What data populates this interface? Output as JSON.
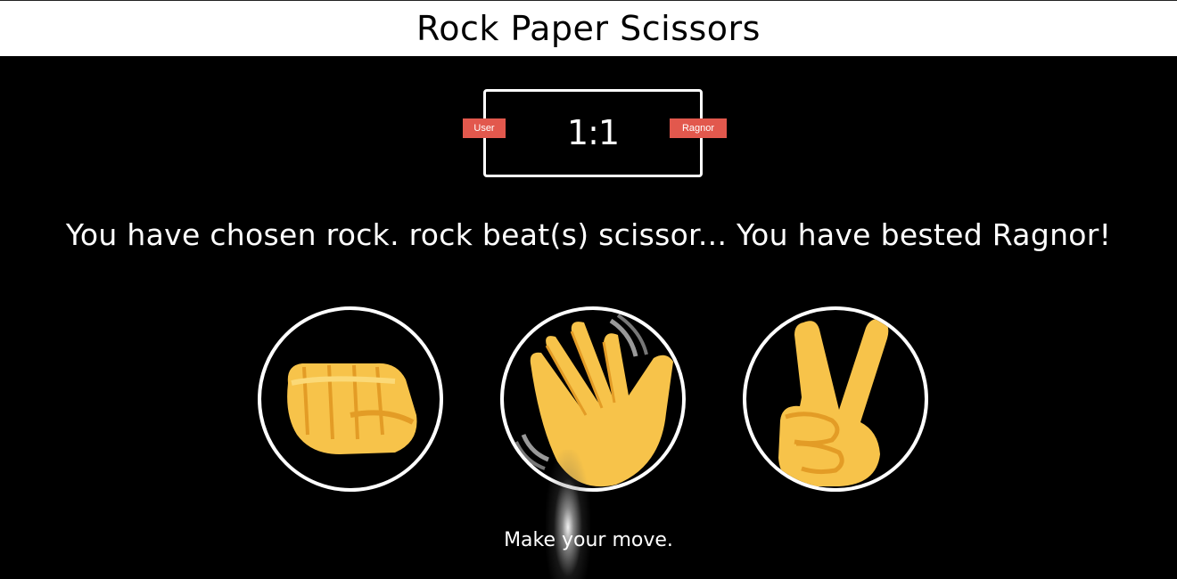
{
  "header": {
    "title": "Rock Paper Scissors"
  },
  "scoreboard": {
    "score": "1:1",
    "user_label": "User",
    "opponent_label": "Ragnor"
  },
  "result_message": "You have chosen rock. rock beat(s) scissor... You have bested Ragnor!",
  "choices": [
    {
      "name": "rock",
      "icon": "fist-icon"
    },
    {
      "name": "paper",
      "icon": "waving-hand-icon"
    },
    {
      "name": "scissors",
      "icon": "victory-hand-icon"
    }
  ],
  "prompt": "Make your move.",
  "colors": {
    "badge": "#e2584d",
    "background": "#000000",
    "emoji": "#f7c34a"
  }
}
